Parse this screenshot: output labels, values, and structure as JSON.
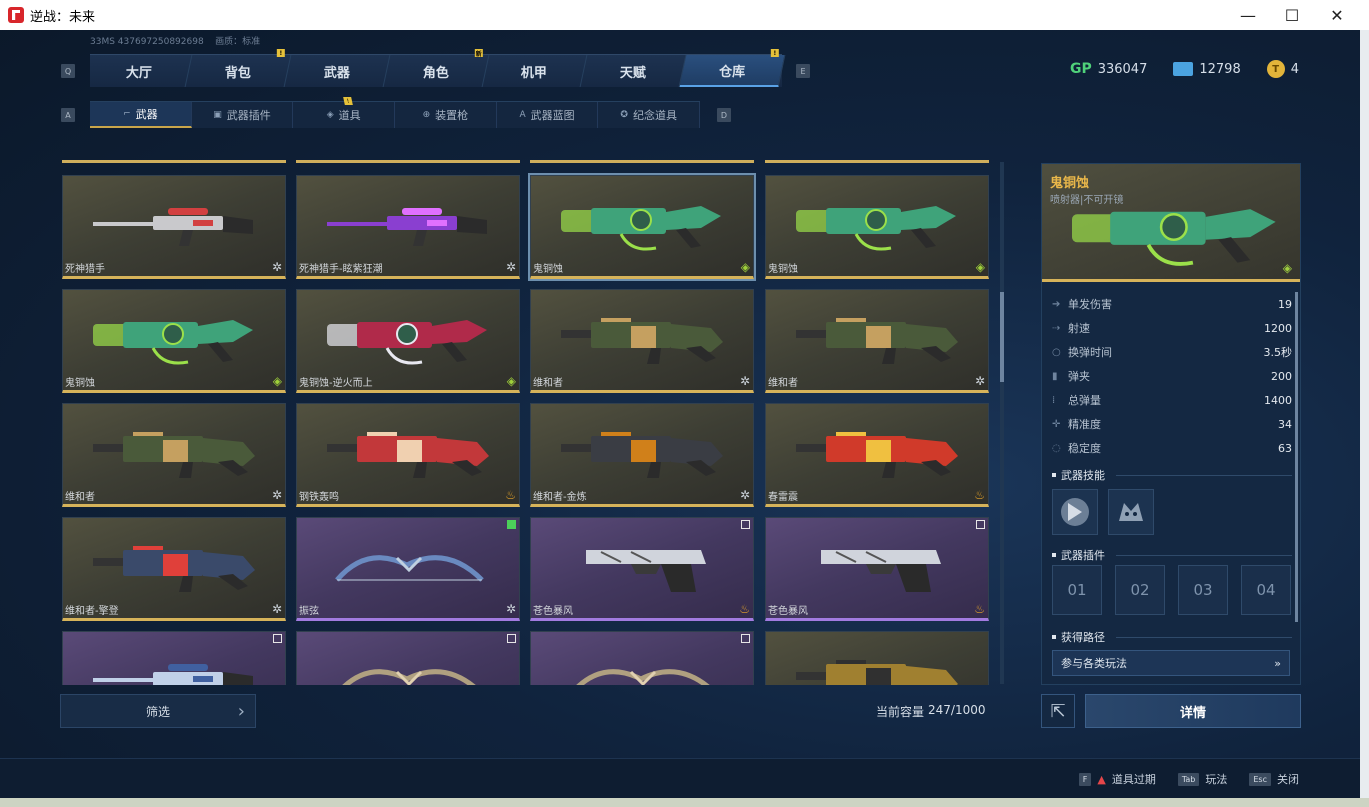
{
  "window": {
    "title": "逆战：未来",
    "buttons": [
      "—",
      "☐",
      "✕"
    ]
  },
  "account": {
    "id_line": "33MS  437697250892698",
    "quality": "画质：标准"
  },
  "keys": {
    "prev_tab": "Q",
    "next_tab": "E",
    "prev_sub": "A",
    "next_sub": "D"
  },
  "main_tabs": [
    {
      "label": "大厅"
    },
    {
      "label": "背包",
      "badge": "!"
    },
    {
      "label": "武器"
    },
    {
      "label": "角色",
      "badge": "新"
    },
    {
      "label": "机甲"
    },
    {
      "label": "天赋"
    },
    {
      "label": "仓库",
      "badge": "!",
      "active": true
    }
  ],
  "currency": {
    "gp_label": "GP",
    "gp": "336047",
    "tickets": "12798",
    "coins": "4"
  },
  "sub_tabs": [
    {
      "label": "武器",
      "icon": "gun-icon",
      "active": true
    },
    {
      "label": "武器插件",
      "icon": "plugin-icon"
    },
    {
      "label": "道具",
      "icon": "item-icon",
      "badge": "!"
    },
    {
      "label": "装置枪",
      "icon": "device-icon"
    },
    {
      "label": "武器蓝图",
      "icon": "blueprint-icon"
    },
    {
      "label": "纪念道具",
      "icon": "medal-icon"
    }
  ],
  "items": [
    {
      "name": "死神猎手",
      "style": "std",
      "gun": "sniper",
      "color": "#c9c9cc",
      "accent": "#d24040",
      "icon": "snowflake-icon"
    },
    {
      "name": "死神猎手-眩紫狂潮",
      "style": "std",
      "gun": "sniper",
      "color": "#8a3fd0",
      "accent": "#e070ff",
      "icon": "snowflake-icon"
    },
    {
      "name": "鬼铜蚀",
      "style": "std",
      "gun": "minigun",
      "color": "#3fa37a",
      "accent": "#9be04a",
      "icon": "ticket-icon",
      "selected": true
    },
    {
      "name": "鬼铜蚀",
      "style": "std",
      "gun": "minigun",
      "color": "#3fa37a",
      "accent": "#9be04a",
      "icon": "ticket-icon"
    },
    {
      "name": "鬼铜蚀",
      "style": "std",
      "gun": "minigun",
      "color": "#3fa37a",
      "accent": "#9be04a",
      "icon": "ticket-icon"
    },
    {
      "name": "鬼铜蚀-逆火而上",
      "style": "std",
      "gun": "minigun",
      "color": "#b02a4a",
      "accent": "#e8e8f0",
      "icon": "ticket-icon"
    },
    {
      "name": "维和者",
      "style": "std",
      "gun": "heavy",
      "color": "#4a5a3a",
      "accent": "#c5a060",
      "icon": "snowflake-icon"
    },
    {
      "name": "维和者",
      "style": "std",
      "gun": "heavy",
      "color": "#4a5a3a",
      "accent": "#c5a060",
      "icon": "snowflake-icon"
    },
    {
      "name": "维和者",
      "style": "std",
      "gun": "heavy",
      "color": "#4a5a3a",
      "accent": "#c5a060",
      "icon": "snowflake-icon"
    },
    {
      "name": "钢铁轰鸣",
      "style": "std",
      "gun": "heavy",
      "color": "#c2383a",
      "accent": "#f0d0b0",
      "icon": "flame-icon"
    },
    {
      "name": "维和者-金炼",
      "style": "std",
      "gun": "heavy",
      "color": "#3a3d44",
      "accent": "#d0801a",
      "icon": "snowflake-icon"
    },
    {
      "name": "春雷震",
      "style": "std",
      "gun": "heavy",
      "color": "#d03a2a",
      "accent": "#f0c040",
      "icon": "flame-icon"
    },
    {
      "name": "维和者-擎登",
      "style": "std",
      "gun": "heavy",
      "color": "#3a4a6a",
      "accent": "#e0403a",
      "icon": "snowflake-icon"
    },
    {
      "name": "振弦",
      "style": "purple",
      "gun": "bow",
      "color": "#6a8ac0",
      "accent": "#c0d0e0",
      "icon": "snowflake-icon",
      "check": "on"
    },
    {
      "name": "苍色暴风",
      "style": "purple",
      "gun": "pistol",
      "color": "#d0d4dc",
      "accent": "#2a2a2a",
      "icon": "flame-icon",
      "check": "off"
    },
    {
      "name": "苍色暴风",
      "style": "purple",
      "gun": "pistol",
      "color": "#d0d4dc",
      "accent": "#2a2a2a",
      "icon": "flame-icon",
      "check": "off"
    },
    {
      "name": "",
      "style": "purple",
      "gun": "sniper",
      "color": "#c0d0e8",
      "accent": "#4060a0",
      "icon": "",
      "check": "off"
    },
    {
      "name": "",
      "style": "purple",
      "gun": "bow",
      "color": "#b0a080",
      "accent": "#e0d0b0",
      "icon": "",
      "check": "off"
    },
    {
      "name": "",
      "style": "purple",
      "gun": "bow",
      "color": "#b0a080",
      "accent": "#e0d0b0",
      "icon": "",
      "check": "off"
    },
    {
      "name": "",
      "style": "std",
      "gun": "heavy",
      "color": "#a08030",
      "accent": "#303030",
      "icon": ""
    }
  ],
  "filter": {
    "label": "筛选"
  },
  "capacity": {
    "label": "当前容量",
    "value": "247/1000"
  },
  "detail": {
    "name": "鬼铜蚀",
    "subtitle": "喷射器|不可开镜",
    "stats": [
      {
        "label": "单发伤害",
        "value": "19",
        "icon": "damage-icon"
      },
      {
        "label": "射速",
        "value": "1200",
        "icon": "firerate-icon"
      },
      {
        "label": "换弹时间",
        "value": "3.5秒",
        "icon": "reload-icon"
      },
      {
        "label": "弹夹",
        "value": "200",
        "icon": "magazine-icon"
      },
      {
        "label": "总弹量",
        "value": "1400",
        "icon": "ammo-icon"
      },
      {
        "label": "精准度",
        "value": "34",
        "icon": "accuracy-icon"
      },
      {
        "label": "稳定度",
        "value": "63",
        "icon": "stability-icon"
      }
    ],
    "skills_title": "武器技能",
    "plugins_title": "武器插件",
    "slots": [
      "01",
      "02",
      "03",
      "04"
    ],
    "route_title": "获得路径",
    "route": "参与各类玩法",
    "details_button": "详情"
  },
  "hints": [
    {
      "key": "F",
      "label": "道具过期",
      "warn": true
    },
    {
      "key": "Tab",
      "label": "玩法"
    },
    {
      "key": "Esc",
      "label": "关闭"
    }
  ]
}
